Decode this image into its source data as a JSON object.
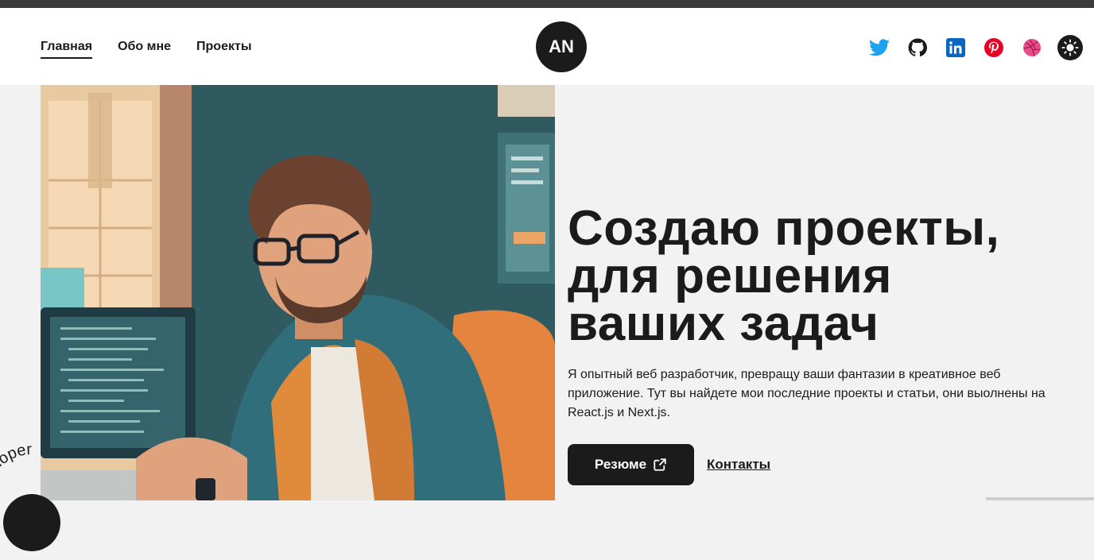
{
  "nav": {
    "items": [
      {
        "label": "Главная",
        "active": true
      },
      {
        "label": "Обо мне",
        "active": false
      },
      {
        "label": "Проекты",
        "active": false
      }
    ]
  },
  "logo": {
    "text": "AN"
  },
  "socials": [
    "twitter-icon",
    "github-icon",
    "linkedin-icon",
    "pinterest-icon",
    "dribbble-icon"
  ],
  "theme_toggle": {
    "icon": "sun-icon"
  },
  "hero": {
    "title_line1": "Создаю проекты,",
    "title_line2": "для решения",
    "title_line3": "ваших задач",
    "description": "Я опытный веб разработчик, превращу ваши фантазии в креативное веб приложение. Тут вы найдете мои последние проекты и статьи, они выолнены на React.js и Next.js.",
    "resume_label": "Резюме",
    "contacts_label": "Контакты"
  },
  "badge": {
    "text": "Developer"
  },
  "colors": {
    "accent": "#1b1b1b",
    "background": "#f2f2f2",
    "twitter": "#1da1f2",
    "linkedin": "#0a66c2",
    "pinterest": "#e60023",
    "dribbble": "#ea4c89"
  }
}
